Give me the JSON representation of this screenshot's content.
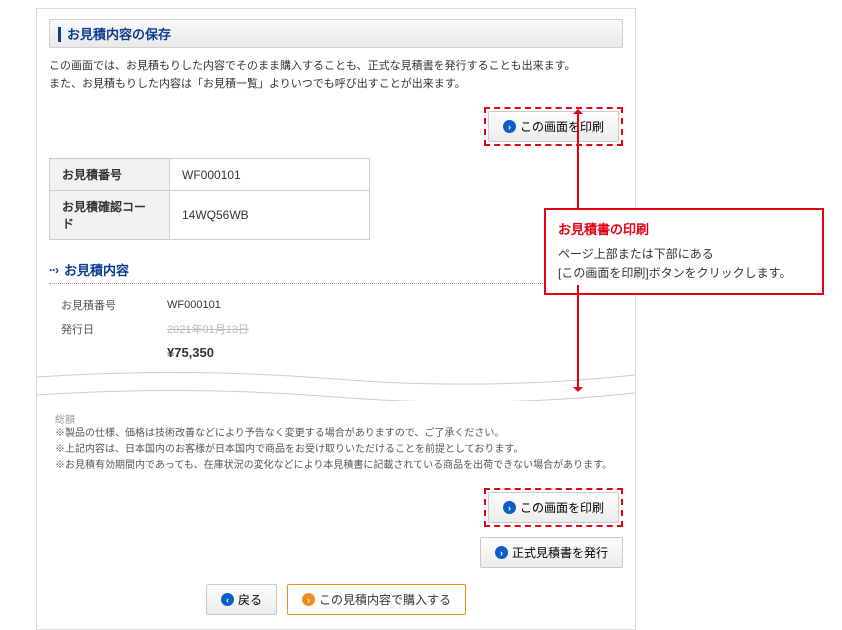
{
  "section_title": "お見積内容の保存",
  "description_line1": "この画面では、お見積もりした内容でそのまま購入することも、正式な見積書を発行することも出来ます。",
  "description_line2": "また、お見積もりした内容は「お見積一覧」よりいつでも呼び出すことが出来ます。",
  "print_button_label": "この画面を印刷",
  "info": {
    "quote_number_label": "お見積番号",
    "quote_number_value": "WF000101",
    "confirm_code_label": "お見積確認コード",
    "confirm_code_value": "14WQ56WB"
  },
  "content_title": "お見積内容",
  "mini": {
    "quote_number_label": "お見積番号",
    "quote_number_value": "WF000101",
    "issue_date_label": "発行日",
    "issue_date_value": "2021年01月13日",
    "total_value": "¥75,350"
  },
  "total_prefix": "総額",
  "notes": {
    "n1": "※製品の仕様、価格は技術改善などにより予告なく変更する場合がありますので、ご了承ください。",
    "n2": "※上記内容は、日本国内のお客様が日本国内で商品をお受け取りいただけることを前提としております。",
    "n3": "※お見積有効期間内であっても、在庫状況の変化などにより本見積書に記載されている商品を出荷できない場合があります。"
  },
  "issue_quote_label": "正式見積書を発行",
  "back_label": "戻る",
  "purchase_label": "この見積内容で購入する",
  "callout": {
    "title": "お見積書の印刷",
    "line1": "ページ上部または下部にある",
    "line2": "[この画面を印刷]ボタンをクリックします。"
  }
}
